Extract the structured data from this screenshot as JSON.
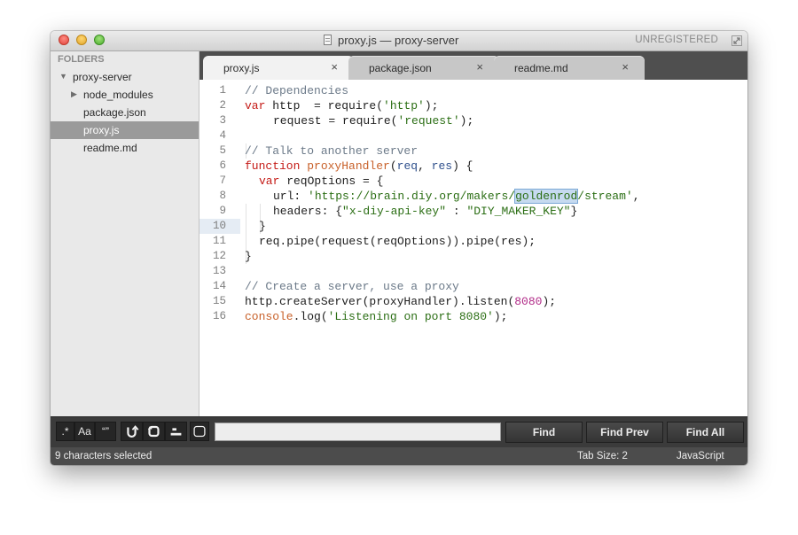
{
  "window": {
    "title": "proxy.js — proxy-server",
    "registration": "UNREGISTERED"
  },
  "sidebar": {
    "heading": "FOLDERS",
    "items": [
      {
        "label": "proxy-server",
        "expanded": true
      },
      {
        "label": "node_modules",
        "expanded": false
      },
      {
        "label": "package.json"
      },
      {
        "label": "proxy.js",
        "selected": true
      },
      {
        "label": "readme.md"
      }
    ]
  },
  "tabs": [
    {
      "label": "proxy.js",
      "active": true
    },
    {
      "label": "package.json"
    },
    {
      "label": "readme.md"
    }
  ],
  "tab_close_glyph": "×",
  "editor": {
    "line_numbers": [
      "1",
      "2",
      "3",
      "4",
      "5",
      "6",
      "7",
      "8",
      "9",
      "10",
      "11",
      "12",
      "13",
      "14",
      "15",
      "16"
    ],
    "current_line": 8,
    "selected_text": "goldenrod",
    "code": {
      "l1": "// Dependencies",
      "l2_kw": "var",
      "l2_a": " http  = require(",
      "l2_s": "'http'",
      "l2_b": ");",
      "l3_a": "request = require(",
      "l3_s": "'request'",
      "l3_b": ");",
      "l5": "// Talk to another server",
      "l6_kw": "function",
      "l6_fn": " proxyHandler",
      "l6_a": "(",
      "l6_p1": "req",
      "l6_b": ", ",
      "l6_p2": "res",
      "l6_c": ") {",
      "l7_kw": "var",
      "l7_a": " reqOptions = {",
      "l8_a": "url: ",
      "l8_s1": "'https://brain.diy.org/makers/",
      "l8_sel": "goldenrod",
      "l8_s2": "/stream'",
      "l8_b": ",",
      "l9_a": "headers: {",
      "l9_s1": "\"x-diy-api-key\"",
      "l9_b": " : ",
      "l9_s2": "\"DIY_MAKER_KEY\"",
      "l9_c": "}",
      "l10": "}",
      "l11": "req.pipe(request(reqOptions)).pipe(res);",
      "l12": "}",
      "l14": "// Create a server, use a proxy",
      "l15_a": "http.createServer(proxyHandler).listen(",
      "l15_n": "8080",
      "l15_b": ");",
      "l16_kw": "console",
      "l16_a": ".log(",
      "l16_s": "'Listening on port 8080'",
      "l16_b": ");"
    }
  },
  "find_bar": {
    "toggles": [
      ".*",
      "Aa",
      "“”"
    ],
    "input_value": "",
    "buttons": [
      "Find",
      "Find Prev",
      "Find All"
    ]
  },
  "status": {
    "selection": "9 characters selected",
    "tab_size": "Tab Size: 2",
    "syntax": "JavaScript"
  },
  "colors": {
    "keyword": "#c41a16",
    "comment": "#6c7a89",
    "string": "#2b6e14",
    "number": "#b12b88",
    "function": "#c8612a",
    "param": "#2e4f8c",
    "selection": "#c6daf0"
  },
  "icons": {
    "close": "close-window-icon",
    "minimize": "minimize-window-icon",
    "maximize": "zoom-window-icon",
    "document": "document-icon",
    "fullscreen": "fullscreen-arrows-icon",
    "folder_disclosure": "disclosure-triangle-icon"
  }
}
